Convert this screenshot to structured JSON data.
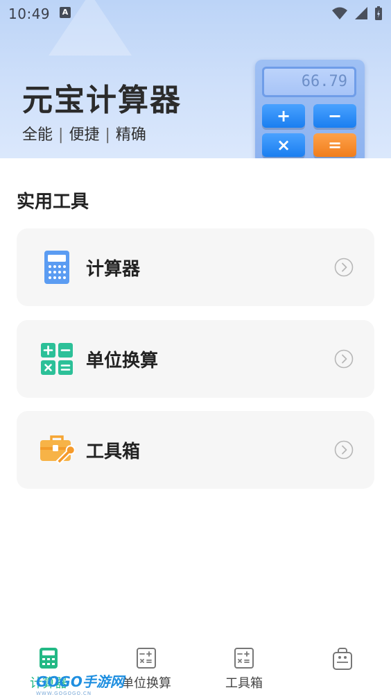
{
  "status_bar": {
    "time": "10:49",
    "notification_icon": "A"
  },
  "banner": {
    "title": "元宝计算器",
    "tagline_parts": [
      "全能",
      "便捷",
      "精确"
    ],
    "tagline_separator": "|",
    "calculator_display": "66.79",
    "calculator_keys": [
      "+",
      "−",
      "×",
      "="
    ]
  },
  "section": {
    "title": "实用工具",
    "cards": [
      {
        "label": "计算器",
        "icon": "calculator-icon"
      },
      {
        "label": "单位换算",
        "icon": "unit-conversion-icon"
      },
      {
        "label": "工具箱",
        "icon": "toolbox-icon"
      }
    ]
  },
  "bottom_nav": {
    "items": [
      {
        "label": "计算器",
        "icon": "calculator-icon",
        "active": true
      },
      {
        "label": "单位换算",
        "icon": "unit-conversion-icon",
        "active": false
      },
      {
        "label": "工具箱",
        "icon": "toolbox-icon",
        "active": false
      },
      {
        "label": "",
        "icon": "bag-icon",
        "active": false
      }
    ]
  },
  "watermark": {
    "text": "GOGO手游网",
    "url": "WWW.GOGOGO.CN"
  },
  "colors": {
    "accent": "#23b985",
    "banner_bg": "#cfe0fa",
    "card_bg": "#f6f6f6"
  }
}
